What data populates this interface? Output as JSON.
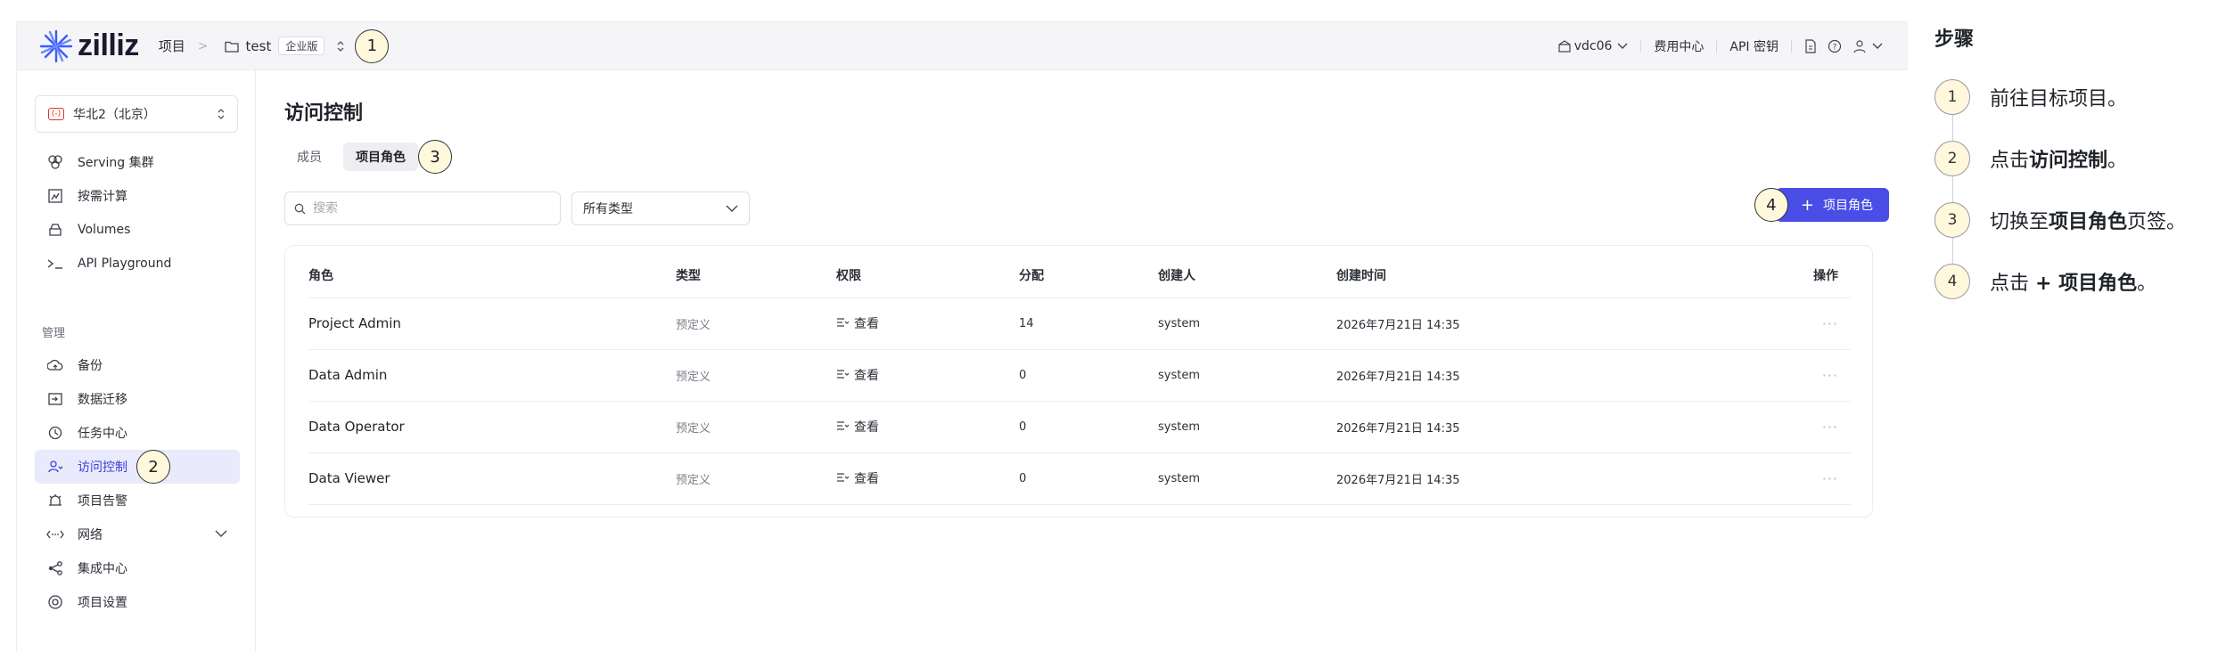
{
  "topbar": {
    "logo_text": "zilliz",
    "crumb_projects": "项目",
    "crumb_sep": ">",
    "project_name": "test",
    "edition_tag": "企业版",
    "step_badge": "1",
    "org_name": "vdc06",
    "billing_label": "费用中心",
    "api_key_label": "API 密钥"
  },
  "sidebar": {
    "region_label": "华北2（北京）",
    "region_flag": "(-)",
    "items_top": [
      {
        "label": "Serving 集群",
        "icon": "cluster-icon"
      },
      {
        "label": "按需计算",
        "icon": "compute-icon"
      },
      {
        "label": "Volumes",
        "icon": "volume-icon"
      },
      {
        "label": "API Playground",
        "icon": "terminal-icon"
      }
    ],
    "section_manage": "管理",
    "items_manage": [
      {
        "label": "备份",
        "icon": "backup-icon"
      },
      {
        "label": "数据迁移",
        "icon": "migration-icon"
      },
      {
        "label": "任务中心",
        "icon": "job-icon"
      },
      {
        "label": "访问控制",
        "icon": "access-control-icon",
        "active": true
      },
      {
        "label": "项目告警",
        "icon": "alarm-icon"
      },
      {
        "label": "网络",
        "icon": "network-icon"
      },
      {
        "label": "集成中心",
        "icon": "integration-icon"
      },
      {
        "label": "项目设置",
        "icon": "settings-icon"
      }
    ],
    "access_badge": "2"
  },
  "main": {
    "title": "访问控制",
    "tabs": [
      {
        "label": "成员"
      },
      {
        "label": "项目角色",
        "active": true
      }
    ],
    "tab_badge": "3",
    "search_placeholder": "搜索",
    "type_filter": "所有类型",
    "add_badge": "4",
    "add_button_label": "项目角色",
    "add_button_plus": "+",
    "table": {
      "headers": [
        "角色",
        "类型",
        "权限",
        "分配",
        "创建人",
        "创建时间",
        "操作"
      ],
      "rows": [
        {
          "role": "Project Admin",
          "type": "预定义",
          "permission": "查看",
          "assigned": "14",
          "creator": "system",
          "created_at": "2026年7月21日 14:35",
          "action": "···"
        },
        {
          "role": "Data Admin",
          "type": "预定义",
          "permission": "查看",
          "assigned": "0",
          "creator": "system",
          "created_at": "2026年7月21日 14:35",
          "action": "···"
        },
        {
          "role": "Data Operator",
          "type": "预定义",
          "permission": "查看",
          "assigned": "0",
          "creator": "system",
          "created_at": "2026年7月21日 14:35",
          "action": "···"
        },
        {
          "role": "Data Viewer",
          "type": "预定义",
          "permission": "查看",
          "assigned": "0",
          "creator": "system",
          "created_at": "2026年7月21日 14:35",
          "action": "···"
        }
      ]
    }
  },
  "steps": {
    "title": "步骤",
    "items": [
      {
        "num": "1",
        "pre": "前往目标项目。",
        "bold": "",
        "post": ""
      },
      {
        "num": "2",
        "pre": "点击",
        "bold": "访问控制",
        "post": "。"
      },
      {
        "num": "3",
        "pre": "切换至",
        "bold": "项目角色",
        "post": "页签。"
      },
      {
        "num": "4",
        "pre": "点击 ",
        "bold": "+ 项目角色",
        "post": "。"
      }
    ]
  },
  "colors": {
    "accent": "#4a4ee6",
    "active_nav_bg": "#e9eafc",
    "badge_bg": "#fff8dd",
    "region_flag": "#e0322c"
  }
}
